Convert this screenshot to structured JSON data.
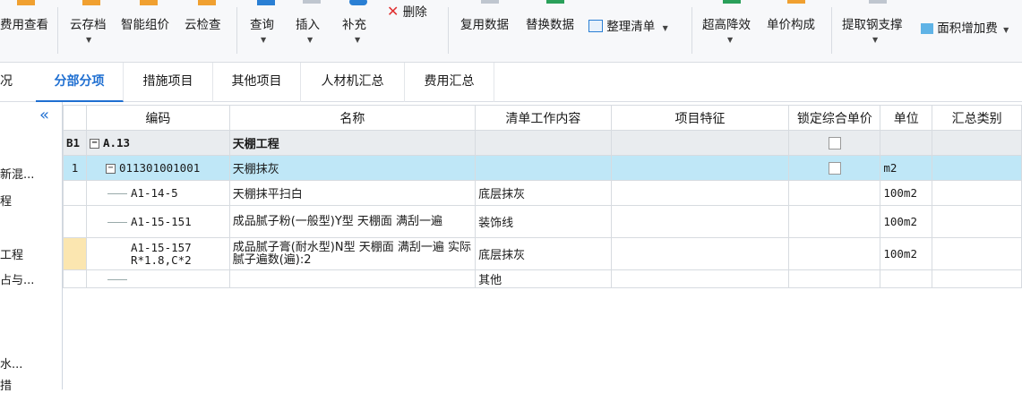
{
  "ribbon": {
    "items": [
      {
        "label": "费用查看",
        "arrow": false
      },
      {
        "label": "云存档",
        "arrow": true
      },
      {
        "label": "智能组价",
        "arrow": false
      },
      {
        "label": "云检查",
        "arrow": false
      },
      {
        "label": "查询",
        "arrow": true
      },
      {
        "label": "插入",
        "arrow": true
      },
      {
        "label": "补充",
        "arrow": true
      },
      {
        "label": "删除",
        "arrow": false
      },
      {
        "label": "复用数据",
        "arrow": false
      },
      {
        "label": "替换数据",
        "arrow": false
      },
      {
        "label": "整理清单",
        "arrow": true
      },
      {
        "label": "超高降效",
        "arrow": true
      },
      {
        "label": "单价构成",
        "arrow": false
      },
      {
        "label": "提取钢支撑",
        "arrow": true
      },
      {
        "label": "面积增加费",
        "arrow": true
      }
    ],
    "delete_glyph": "✕"
  },
  "tabs": [
    "况",
    "分部分项",
    "措施项目",
    "其他项目",
    "人材机汇总",
    "费用汇总"
  ],
  "active_tab": "分部分项",
  "left_panel": {
    "collapse_glyph": "«",
    "items": [
      "新混...",
      "程",
      "工程",
      "占与...",
      "水...",
      "措"
    ]
  },
  "table": {
    "headers": [
      "编码",
      "名称",
      "清单工作内容",
      "项目特征",
      "锁定综合单价",
      "单位",
      "汇总类别"
    ],
    "rows": [
      {
        "rownum": "B1",
        "code": "A.13",
        "name": "天棚工程",
        "content": "",
        "feature": "",
        "lock": true,
        "unit": "",
        "category": ""
      },
      {
        "rownum": "1",
        "code": "011301001001",
        "name": "天棚抹灰",
        "content": "",
        "feature": "",
        "lock": true,
        "unit": "m2",
        "category": ""
      },
      {
        "rownum": "",
        "code": "A1-14-5",
        "name": "天棚抹平扫白",
        "content": "底层抹灰",
        "feature": "",
        "lock": false,
        "unit": "100m2",
        "category": ""
      },
      {
        "rownum": "",
        "code": "A1-15-151",
        "name": "成品腻子粉(一般型)Y型 天棚面 满刮一遍",
        "content": "装饰线",
        "feature": "",
        "lock": false,
        "unit": "100m2",
        "category": ""
      },
      {
        "rownum": "",
        "code": "A1-15-157 R*1.8,C*2",
        "code_line1": "A1-15-157",
        "code_line2": "R*1.8,C*2",
        "name": "成品腻子膏(耐水型)N型 天棚面 满刮一遍  实际腻子遍数(遍):2",
        "content": "底层抹灰",
        "feature": "",
        "lock": false,
        "unit": "100m2",
        "category": ""
      },
      {
        "rownum": "",
        "code": "",
        "name": "",
        "content": "其他",
        "feature": "",
        "lock": false,
        "unit": "",
        "category": ""
      }
    ]
  },
  "colors": {
    "accent": "#1f6fd1",
    "selected_row": "#bfe7f7",
    "section_row": "#e9ecef",
    "marker": "#fbe6b0"
  }
}
